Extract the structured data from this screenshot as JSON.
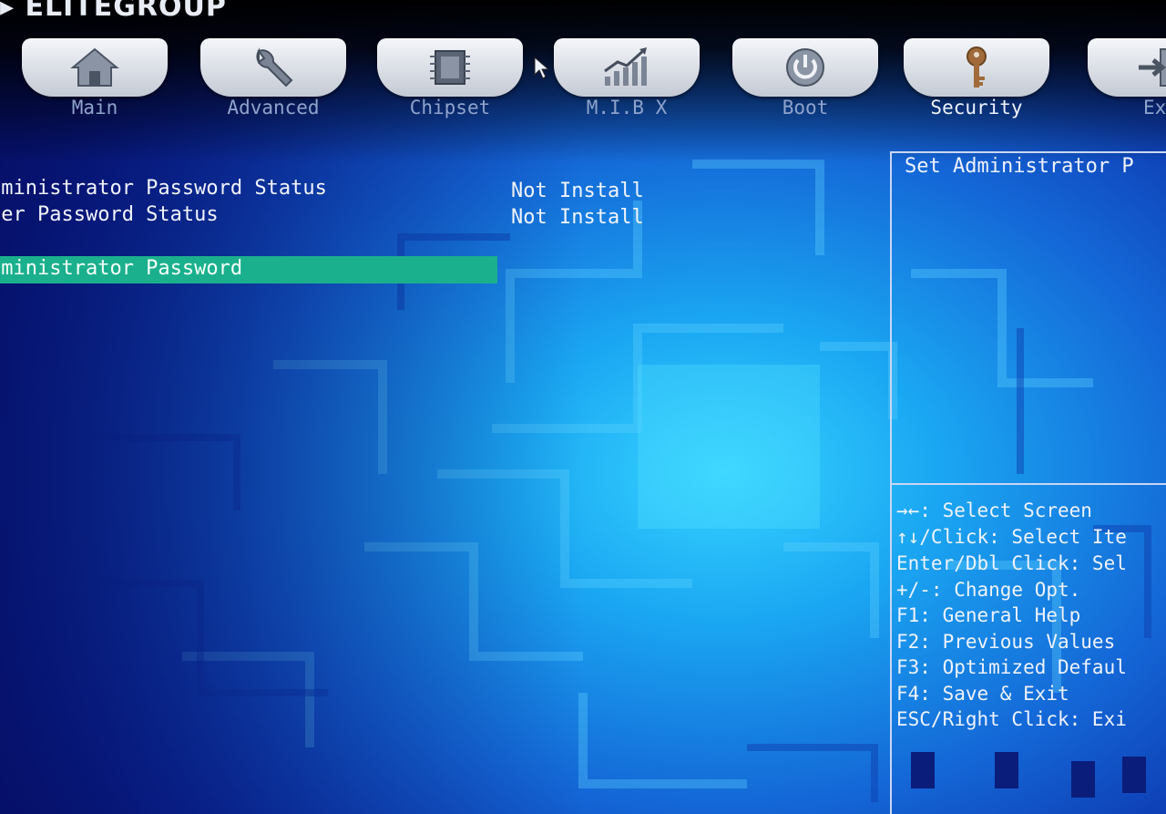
{
  "brand": {
    "name": "ELITEGROUP"
  },
  "tabs": [
    {
      "label": "Main",
      "icon": "home-icon",
      "active": false
    },
    {
      "label": "Advanced",
      "icon": "wrench-icon",
      "active": false
    },
    {
      "label": "Chipset",
      "icon": "chip-icon",
      "active": false
    },
    {
      "label": "M.I.B X",
      "icon": "chart-icon",
      "active": false
    },
    {
      "label": "Boot",
      "icon": "power-icon",
      "active": false
    },
    {
      "label": "Security",
      "icon": "key-icon",
      "active": true
    },
    {
      "label": "Exi",
      "icon": "exit-icon",
      "active": false
    }
  ],
  "settings": [
    {
      "label": "dministrator Password Status",
      "value": "Not Install"
    },
    {
      "label": "ser Password Status",
      "value": "Not Install"
    },
    {
      "label": "dministrator Password",
      "value": ""
    }
  ],
  "help": {
    "title": "Set Administrator P",
    "keys": [
      "→←: Select Screen",
      "↑↓/Click: Select Ite",
      "Enter/Dbl Click: Sel",
      "+/-: Change Opt.",
      "F1: General Help",
      "F2: Previous Values",
      "F3: Optimized Defaul",
      "F4: Save & Exit",
      "ESC/Right Click: Exi"
    ]
  },
  "colors": {
    "background_dark": "#0a1a8a",
    "circuit_light": "#1ea4f0",
    "highlight": "#1bb08d",
    "text": "#f1f4ff",
    "tab_label_inactive": "#8ea3cc"
  }
}
